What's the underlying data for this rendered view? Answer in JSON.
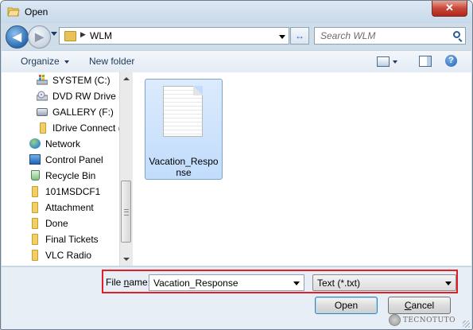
{
  "window": {
    "title": "Open",
    "close_glyph": "✕"
  },
  "nav": {
    "back_glyph": "◀",
    "forward_glyph": "▶",
    "address_separator": "▶",
    "address_path": "WLM",
    "refresh_glyph": "↔",
    "search_placeholder": "Search WLM"
  },
  "toolbar": {
    "organize_label": "Organize",
    "new_folder_label": "New folder",
    "help_glyph": "?"
  },
  "navpane": {
    "items": [
      {
        "label": "SYSTEM (C:)",
        "icon": "system-drive-icon"
      },
      {
        "label": "DVD RW Drive (D:)",
        "icon": "dvd-drive-icon"
      },
      {
        "label": "GALLERY (F:)",
        "icon": "drive-icon"
      },
      {
        "label": "IDrive Connect (I:)",
        "icon": "folder-icon"
      },
      {
        "label": "Network",
        "icon": "network-icon"
      },
      {
        "label": "Control Panel",
        "icon": "control-panel-icon"
      },
      {
        "label": "Recycle Bin",
        "icon": "recycle-bin-icon"
      },
      {
        "label": "101MSDCF1",
        "icon": "folder-icon"
      },
      {
        "label": "Attachment",
        "icon": "folder-icon"
      },
      {
        "label": "Done",
        "icon": "folder-icon"
      },
      {
        "label": "Final Tickets",
        "icon": "folder-icon"
      },
      {
        "label": "VLC Radio",
        "icon": "folder-icon"
      }
    ]
  },
  "files": [
    {
      "name": "Vacation_Response",
      "icon": "text-document-icon",
      "selected": true
    }
  ],
  "bottom": {
    "file_name_label_pre": "File ",
    "file_name_label_acc": "n",
    "file_name_label_post": "ame:",
    "file_name_value": "Vacation_Response",
    "file_type_value": "Text (*.txt)",
    "open_label": "Open",
    "cancel_label_pre": "",
    "cancel_label_acc": "C",
    "cancel_label_post": "ancel",
    "highlight_color": "#e31e24"
  },
  "watermark": {
    "text": "TECNOTUTO"
  }
}
